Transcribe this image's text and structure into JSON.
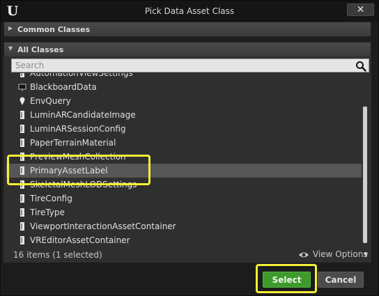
{
  "window": {
    "title": "Pick Data Asset Class",
    "logo": "U",
    "close_label": "✕"
  },
  "sections": {
    "common_classes": "Common Classes",
    "all_classes": "All Classes"
  },
  "search": {
    "placeholder": "Search"
  },
  "class_list": [
    {
      "label": "AutomationViewSettings",
      "icon": "data-asset-icon",
      "selected": false
    },
    {
      "label": "BlackboardData",
      "icon": "blackboard-icon",
      "selected": false
    },
    {
      "label": "EnvQuery",
      "icon": "env-query-icon",
      "selected": false
    },
    {
      "label": "LuminARCandidateImage",
      "icon": "data-asset-icon",
      "selected": false
    },
    {
      "label": "LuminARSessionConfig",
      "icon": "data-asset-icon",
      "selected": false
    },
    {
      "label": "PaperTerrainMaterial",
      "icon": "data-asset-icon",
      "selected": false
    },
    {
      "label": "PreviewMeshCollection",
      "icon": "data-asset-icon",
      "selected": false
    },
    {
      "label": "PrimaryAssetLabel",
      "icon": "data-asset-icon",
      "selected": true
    },
    {
      "label": "SkeletalMeshLODSettings",
      "icon": "data-asset-icon",
      "selected": false
    },
    {
      "label": "TireConfig",
      "icon": "data-asset-icon",
      "selected": false
    },
    {
      "label": "TireType",
      "icon": "data-asset-icon",
      "selected": false
    },
    {
      "label": "ViewportInteractionAssetContainer",
      "icon": "data-asset-icon",
      "selected": false
    },
    {
      "label": "VREditorAssetContainer",
      "icon": "data-asset-icon",
      "selected": false
    }
  ],
  "status": {
    "count_text": "16 items (1 selected)"
  },
  "view_options": {
    "label": "View Options"
  },
  "buttons": {
    "select": "Select",
    "cancel": "Cancel"
  },
  "colors": {
    "select_button": "#3e9a2b",
    "highlight": "#f5f035",
    "selected_row": "#565656"
  }
}
